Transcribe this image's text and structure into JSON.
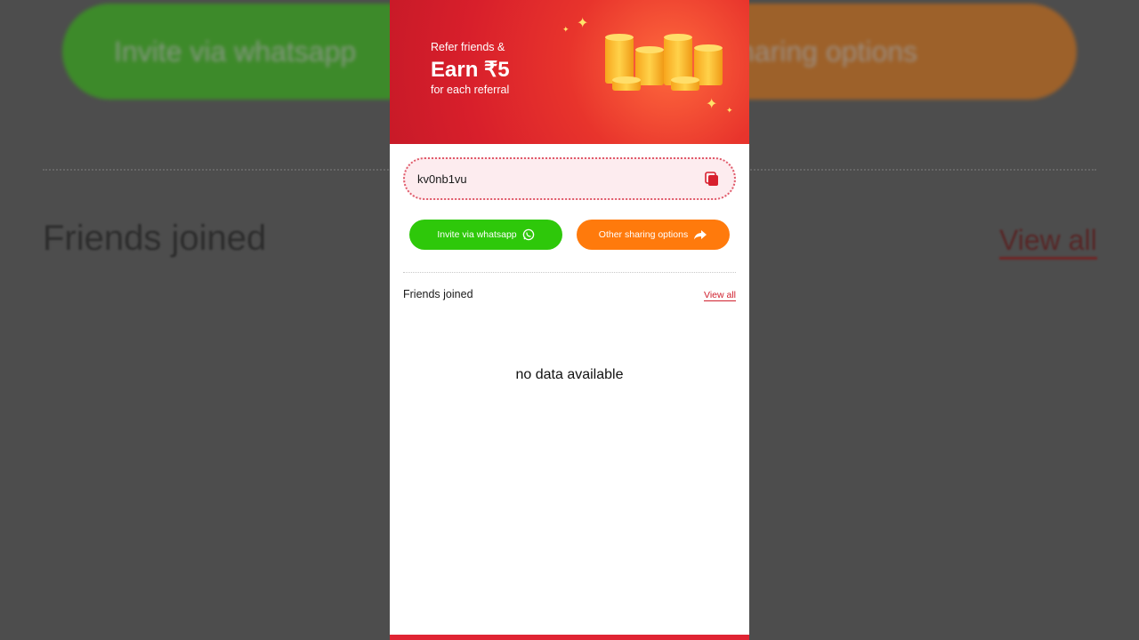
{
  "backdrop": {
    "whatsapp_label": "Invite via whatsapp",
    "share_label": "haring options",
    "friends_title": "Friends joined",
    "view_all": "View all"
  },
  "hero": {
    "line1": "Refer friends &",
    "earn": "Earn ₹5",
    "line3": "for each referral",
    "image_icon": "coins-stack-icon"
  },
  "referral": {
    "code": "kv0nb1vu",
    "copy_icon": "copy-icon"
  },
  "actions": {
    "whatsapp_label": "Invite via whatsapp",
    "whatsapp_icon": "whatsapp-icon",
    "share_label": "Other sharing options",
    "share_icon": "share-arrow-icon"
  },
  "friends": {
    "title": "Friends joined",
    "view_all": "View all",
    "empty_text": "no data available"
  },
  "colors": {
    "brand_red": "#d81f2b",
    "whatsapp_green": "#2ec80a",
    "share_orange": "#ff7a0c",
    "code_bg": "#fdecef"
  }
}
